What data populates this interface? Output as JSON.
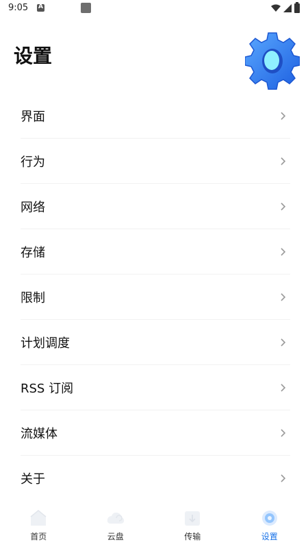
{
  "status_bar": {
    "time": "9:05"
  },
  "header": {
    "title": "设置"
  },
  "settings": {
    "items": [
      {
        "label": "界面"
      },
      {
        "label": "行为"
      },
      {
        "label": "网络"
      },
      {
        "label": "存储"
      },
      {
        "label": "限制"
      },
      {
        "label": "计划调度"
      },
      {
        "label": "RSS 订阅"
      },
      {
        "label": "流媒体"
      },
      {
        "label": "关于"
      }
    ]
  },
  "bottom_nav": {
    "items": [
      {
        "label": "首页",
        "icon": "home-icon"
      },
      {
        "label": "云盘",
        "icon": "cloud-icon"
      },
      {
        "label": "传输",
        "icon": "transfer-icon"
      },
      {
        "label": "设置",
        "icon": "settings-icon",
        "active": true
      }
    ]
  },
  "colors": {
    "accent": "#1a73e8",
    "gear_blue": "#2f7cf6"
  }
}
